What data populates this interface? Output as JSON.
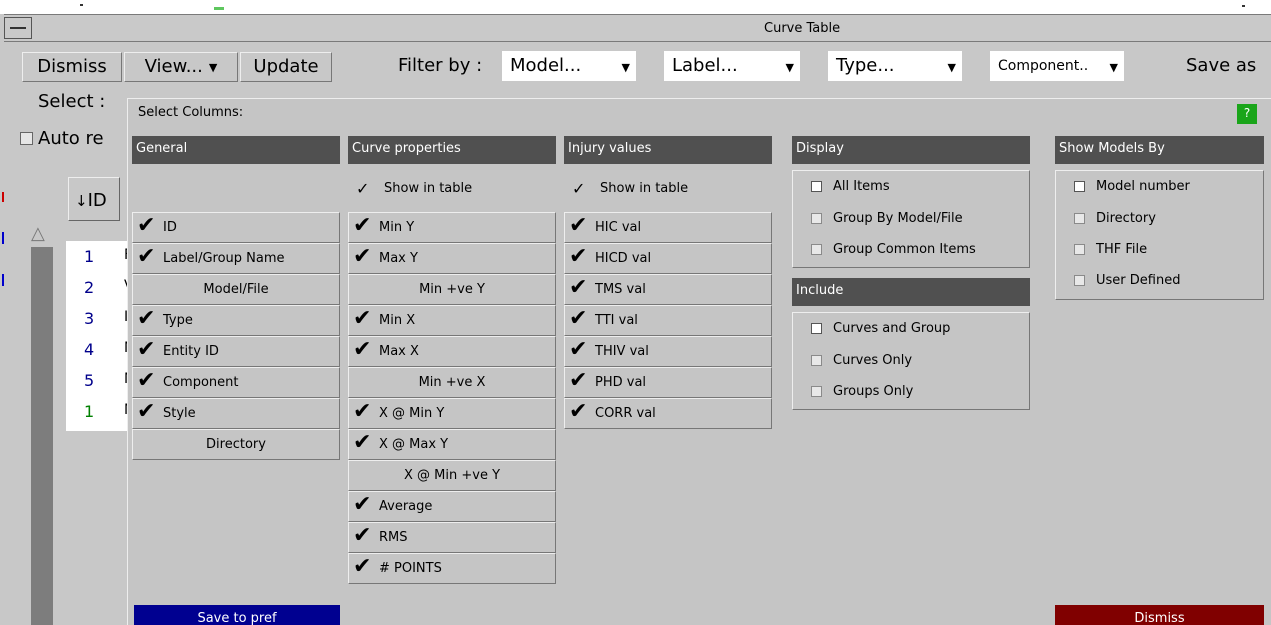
{
  "window": {
    "title": "Curve Table"
  },
  "toolbar": {
    "dismiss": "Dismiss",
    "view": "View...",
    "update": "Update",
    "filter_label": "Filter by :",
    "filters": [
      "Model...",
      "Label...",
      "Type...",
      "Component.."
    ],
    "save_as": "Save as"
  },
  "side": {
    "select_label": "Select :",
    "auto_label": "Auto re"
  },
  "table": {
    "id_header": "ID",
    "scroll_up": "△",
    "rows": [
      {
        "id": "1",
        "label": "F"
      },
      {
        "id": "2",
        "label": "V"
      },
      {
        "id": "3",
        "label": "I"
      },
      {
        "id": "4",
        "label": "N"
      },
      {
        "id": "5",
        "label": "N"
      },
      {
        "id": "1",
        "label": "N"
      }
    ]
  },
  "popup": {
    "title": "Select Columns:",
    "help": "?",
    "general": {
      "heading": "General",
      "items": [
        {
          "label": "ID",
          "checked": true
        },
        {
          "label": "Label/Group Name",
          "checked": true
        },
        {
          "label": "Model/File",
          "checked": false
        },
        {
          "label": "Type",
          "checked": true
        },
        {
          "label": "Entity ID",
          "checked": true
        },
        {
          "label": "Component",
          "checked": true
        },
        {
          "label": "Style",
          "checked": true
        },
        {
          "label": "Directory",
          "checked": false
        }
      ]
    },
    "curve": {
      "heading": "Curve properties",
      "show_in_table": "Show in table",
      "items": [
        {
          "label": "Min Y",
          "checked": true
        },
        {
          "label": "Max Y",
          "checked": true
        },
        {
          "label": "Min +ve Y",
          "checked": false
        },
        {
          "label": "Min X",
          "checked": true
        },
        {
          "label": "Max X",
          "checked": true
        },
        {
          "label": "Min +ve X",
          "checked": false
        },
        {
          "label": "X @ Min Y",
          "checked": true
        },
        {
          "label": "X @ Max Y",
          "checked": true
        },
        {
          "label": "X @ Min +ve Y",
          "checked": false
        },
        {
          "label": "Average",
          "checked": true
        },
        {
          "label": "RMS",
          "checked": true
        },
        {
          "label": "# POINTS",
          "checked": true
        }
      ]
    },
    "injury": {
      "heading": "Injury values",
      "show_in_table": "Show in table",
      "items": [
        {
          "label": "HIC val",
          "checked": true
        },
        {
          "label": "HICD val",
          "checked": true
        },
        {
          "label": "TMS val",
          "checked": true
        },
        {
          "label": "TTI val",
          "checked": true
        },
        {
          "label": "THIV val",
          "checked": true
        },
        {
          "label": "PHD val",
          "checked": true
        },
        {
          "label": "CORR val",
          "checked": true
        }
      ]
    },
    "display": {
      "heading": "Display",
      "options": [
        "All Items",
        "Group By Model/File",
        "Group Common Items"
      ],
      "selected": 0
    },
    "include": {
      "heading": "Include",
      "options": [
        "Curves and Group",
        "Curves Only",
        "Groups Only"
      ],
      "selected": 0
    },
    "show_models": {
      "heading": "Show Models By",
      "options": [
        "Model number",
        "Directory",
        "THF File",
        "User Defined"
      ],
      "selected": 0
    },
    "save_pref": "Save to pref",
    "dismiss": "Dismiss"
  },
  "colors": {
    "section_header": "#505050",
    "save_pref_bg": "#000090",
    "dismiss_bg": "#800000",
    "help_bg": "#1aa51a",
    "row_id": "#00008b",
    "row_id_alt": "#008000"
  }
}
